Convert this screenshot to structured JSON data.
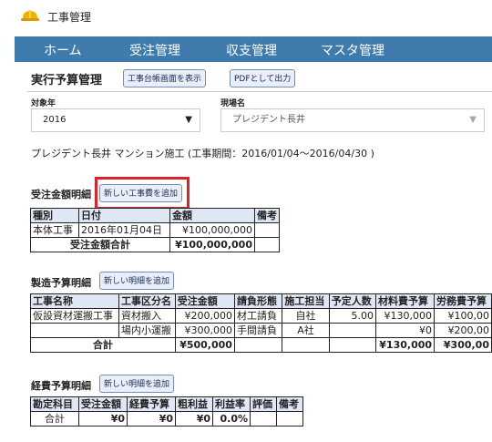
{
  "app": {
    "title": "工事管理"
  },
  "nav": {
    "items": [
      "ホーム",
      "受注管理",
      "収支管理",
      "マスタ管理"
    ]
  },
  "page": {
    "title": "実行予算管理",
    "btn_daicho": "工事台帳画面を表示",
    "btn_pdf": "PDFとして出力"
  },
  "filters": {
    "year_label": "対象年",
    "year_value": "2016",
    "site_label": "現場名",
    "site_value": "プレジデント長井"
  },
  "project": {
    "summary": "プレジデント長井 マンション施工 (工事期間：2016/01/04～2016/04/30 )"
  },
  "order": {
    "title": "受注金額明細",
    "add_button": "新しい工事費を追加",
    "headers": [
      "種別",
      "日付",
      "金額",
      "備考"
    ],
    "rows": [
      {
        "type": "本体工事",
        "date": "2016年01月04日",
        "amount": "¥100,000,000",
        "note": ""
      }
    ],
    "total_label": "受注金額合計",
    "total_amount": "¥100,000,000"
  },
  "manufacturing": {
    "title": "製造予算明細",
    "add_button": "新しい明細を追加",
    "headers": [
      "工事名称",
      "工事区分名",
      "受注金額",
      "請負形態",
      "施工担当",
      "予定人数",
      "材料費予算",
      "労務費予算"
    ],
    "rows": [
      {
        "name": "仮設資材運搬工事",
        "division": "資材搬入",
        "amount": "¥200,000",
        "form": "材工請負",
        "staff": "自社",
        "people": "5.00",
        "material": "¥130,000",
        "labor": "¥100,00"
      },
      {
        "name": "",
        "division": "場内小運搬",
        "amount": "¥300,000",
        "form": "手間請負",
        "staff": "A社",
        "people": "",
        "material": "¥0",
        "labor": "¥200,00"
      }
    ],
    "total_label": "合計",
    "total_amount": "¥500,000",
    "total_material": "¥130,000",
    "total_labor": "¥300,00"
  },
  "expense": {
    "title": "経費予算明細",
    "add_button": "新しい明細を追加",
    "headers": [
      "勘定科目",
      "受注金額",
      "経費予算",
      "粗利益",
      "利益率",
      "評価",
      "備考"
    ],
    "total": {
      "label": "合計",
      "amount": "¥0",
      "budget": "¥0",
      "profit": "¥0",
      "rate": "0.0%",
      "eval": "",
      "note": ""
    }
  },
  "colors": {
    "nav_bg": "#3f7cad",
    "highlight": "#e0202a",
    "header_bg": "#dfe6f4",
    "helmet": "#f0b400"
  }
}
